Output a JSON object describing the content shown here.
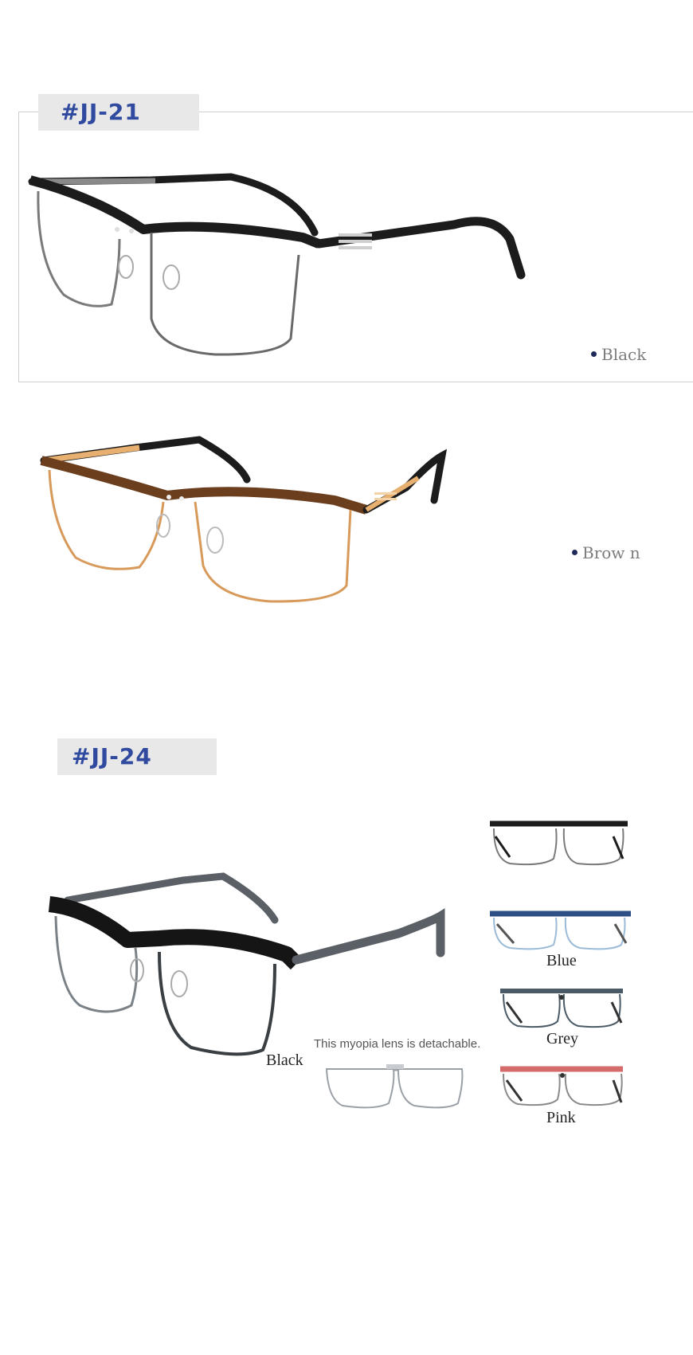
{
  "products": [
    {
      "tag": "#JJ-21",
      "colors": [
        {
          "label": "Black",
          "frame_color": "#1c1c1c",
          "rim_color": "#6a6a6a"
        },
        {
          "label": "Brow n",
          "frame_color": "#6b3e1e",
          "rim_color": "#d89a5a"
        }
      ]
    },
    {
      "tag": "#JJ-24",
      "main_label": "Black",
      "lens_note": "This myopia lens is detachable.",
      "variants": [
        {
          "label": "",
          "frame_color": "#1c1c1c"
        },
        {
          "label": "Blue",
          "frame_color": "#2e4f86"
        },
        {
          "label": "Grey",
          "frame_color": "#4a5a66"
        },
        {
          "label": "Pink",
          "frame_color": "#d46a6a"
        }
      ]
    }
  ]
}
